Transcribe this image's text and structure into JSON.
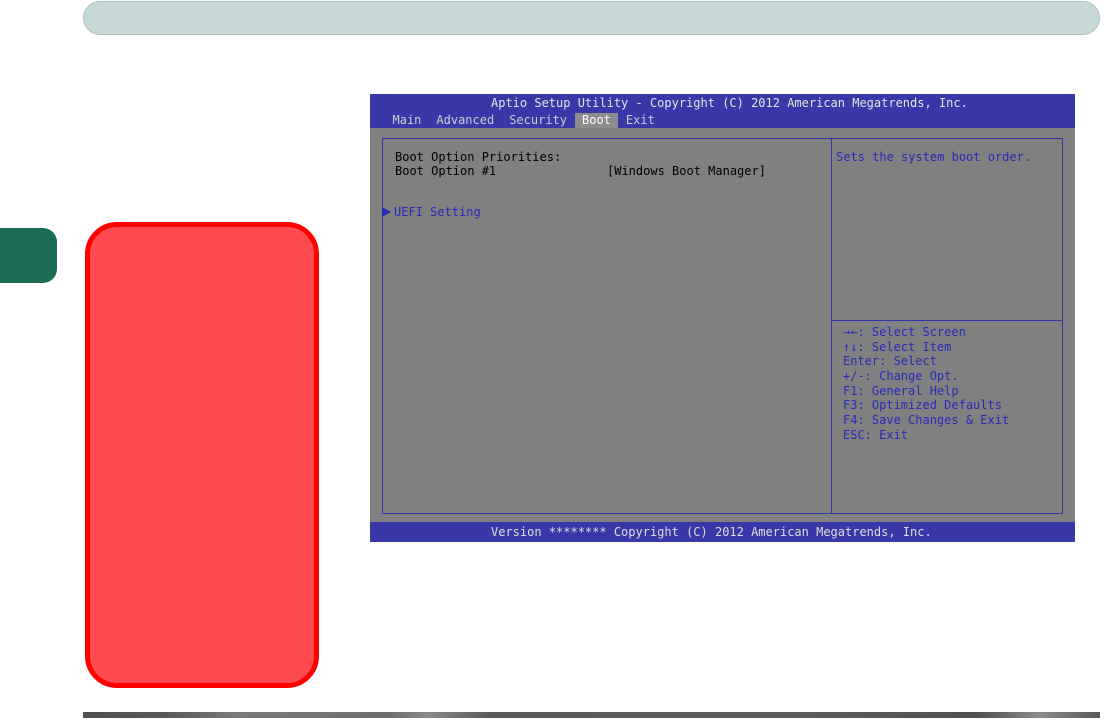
{
  "bios": {
    "title": "Aptio Setup Utility - Copyright (C) 2012 American Megatrends, Inc.",
    "menu": [
      {
        "label": "Main",
        "selected": false
      },
      {
        "label": "Advanced",
        "selected": false
      },
      {
        "label": "Security",
        "selected": false
      },
      {
        "label": "Boot",
        "selected": true
      },
      {
        "label": "Exit",
        "selected": false
      }
    ],
    "main": {
      "section_heading": "Boot Option Priorities:",
      "boot_option": {
        "label": "Boot Option #1",
        "value": "[Windows Boot Manager]"
      },
      "submenu": {
        "icon": "triangle-right-icon",
        "label": "UEFI Setting"
      }
    },
    "help": {
      "description": "Sets the system boot order.",
      "keys": [
        "→←: Select Screen",
        "↑↓: Select Item",
        "Enter: Select",
        "+/-: Change Opt.",
        "F1: General Help",
        "F3: Optimized Defaults",
        "F4: Save Changes & Exit",
        "ESC: Exit"
      ]
    },
    "footer": "Version ******** Copyright (C) 2012 American Megatrends, Inc."
  },
  "colors": {
    "header_bar": "#c6d9d6",
    "chapter_tab": "#1b6b57",
    "note_box_fill": "#ff4b50",
    "note_box_border": "#ff0000",
    "bios_blue": "#3838a8",
    "bios_gray": "#808080",
    "bios_highlight": "#8c8c8c",
    "bios_line": "#3434ac",
    "bios_text_blue": "#2a2ab8",
    "bios_text_dark": "#000000"
  }
}
